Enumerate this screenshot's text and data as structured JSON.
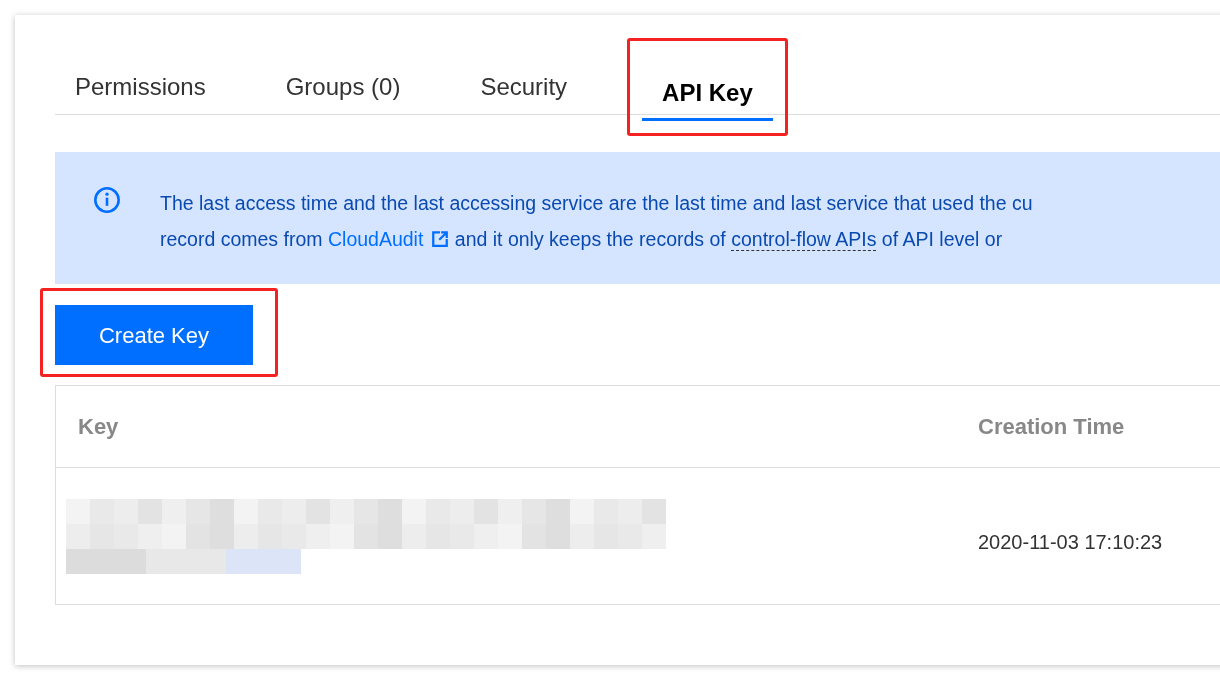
{
  "tabs": [
    {
      "label": "Permissions",
      "selected": false,
      "highlighted": false
    },
    {
      "label": "Groups (0)",
      "selected": false,
      "highlighted": false
    },
    {
      "label": "Security",
      "selected": false,
      "highlighted": false
    },
    {
      "label": "API Key",
      "selected": true,
      "highlighted": true
    }
  ],
  "notice": {
    "line_1": "The last access time and the last accessing service are the last time and last service that used the cu",
    "line_2_start": "record comes from ",
    "link": "CloudAudit",
    "line_2_middle": " and it only keeps the records of ",
    "term": "control-flow APIs",
    "line_2_end": " of API level or"
  },
  "create_button": {
    "label": "Create Key",
    "highlighted": true
  },
  "table": {
    "columns": [
      "Key",
      "Creation Time"
    ],
    "rows": [
      {
        "key": {
          "kind": "redacted"
        },
        "creation_time": "2020-11-03 17:10:23"
      }
    ]
  }
}
